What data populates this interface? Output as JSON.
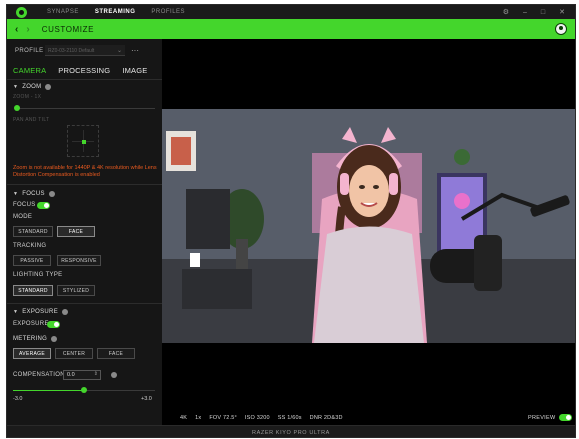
{
  "topbar": {
    "nav": [
      "SYNAPSE",
      "STREAMING",
      "PROFILES"
    ],
    "active_nav": "STREAMING",
    "window_controls": [
      "⚙",
      "–",
      "□",
      "✕"
    ]
  },
  "header": {
    "back": "‹",
    "forward": "›",
    "title": "CUSTOMIZE"
  },
  "profile": {
    "label": "PROFILE",
    "value": "RZ0-03-2110 Default",
    "more": "···"
  },
  "tabs": [
    "CAMERA",
    "PROCESSING",
    "IMAGE"
  ],
  "active_tab": "CAMERA",
  "zoom": {
    "title": "ZOOM",
    "value_text": "ZOOM - 1X",
    "slider_level": 0.0,
    "pan_tilt_label": "PAN AND TILT",
    "warning": "Zoom is not available for 1440P & 4K resolution while Lens Distortion Compensation is enabled"
  },
  "focus": {
    "title": "FOCUS",
    "toggle_label": "FOCUS",
    "mode_label": "MODE",
    "modes": [
      "STANDARD",
      "FACE"
    ],
    "tracking_label": "TRACKING",
    "tracking": [
      "PASSIVE",
      "RESPONSIVE"
    ],
    "lighting_label": "LIGHTING TYPE",
    "lighting": [
      "STANDARD",
      "STYLIZED"
    ]
  },
  "exposure": {
    "title": "EXPOSURE",
    "toggle_label": "EXPOSURE",
    "metering_label": "METERING",
    "metering": [
      "AVERAGE",
      "CENTER",
      "FACE"
    ],
    "compensation_label": "COMPENSATION",
    "compensation_value": "0.0",
    "min_label": "-3.0",
    "max_label": "+3.0",
    "level": 0.5
  },
  "status": [
    "4K",
    "1x",
    "FOV 72.5°",
    "ISO 3200",
    "SS 1/60s",
    "DNR 2D&3D"
  ],
  "preview_label": "PREVIEW",
  "footer": "RAZER KIYO PRO ULTRA",
  "colors": {
    "accent": "#44d62c",
    "warning": "#e85a1f",
    "background": "#111111"
  }
}
